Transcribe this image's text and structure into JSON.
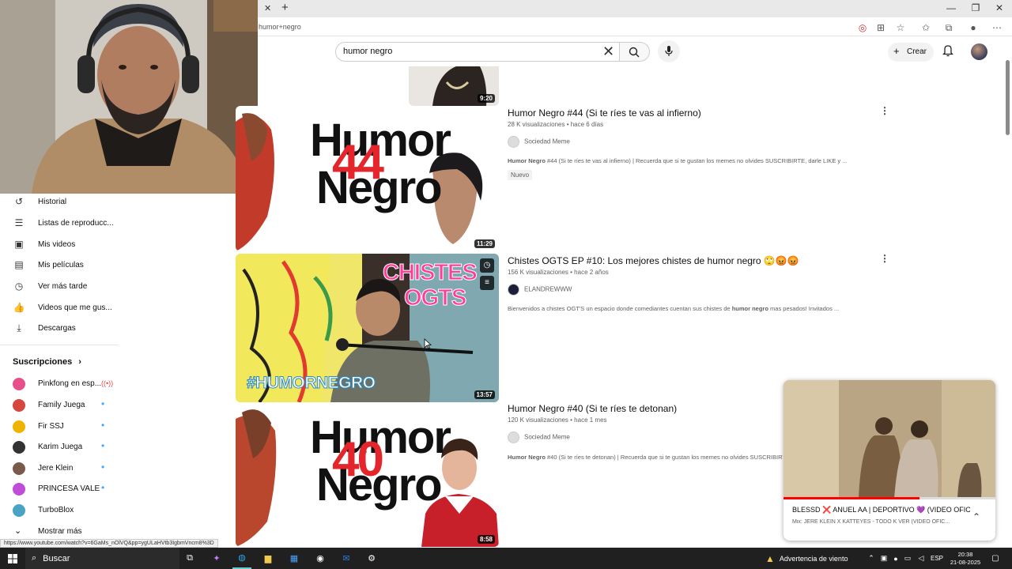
{
  "browser": {
    "url": "humor+negro",
    "tab_close": "✕",
    "new_tab": "+"
  },
  "header": {
    "search_query": "humor negro",
    "create_label": "Crear"
  },
  "sidebar": {
    "items": [
      {
        "icon": "history-icon",
        "label": "Historial"
      },
      {
        "icon": "playlist-icon",
        "label": "Listas de reproducc..."
      },
      {
        "icon": "my-videos-icon",
        "label": "Mis videos"
      },
      {
        "icon": "movies-icon",
        "label": "Mis películas"
      },
      {
        "icon": "watch-later-icon",
        "label": "Ver más tarde"
      },
      {
        "icon": "liked-icon",
        "label": "Videos que me gus..."
      },
      {
        "icon": "download-icon",
        "label": "Descargas"
      }
    ],
    "subscriptions_title": "Suscripciones",
    "subscriptions": [
      {
        "name": "Pinkfong en esp...",
        "color": "#e8508a",
        "live": true
      },
      {
        "name": "Family Juega",
        "color": "#d6473f",
        "live": false
      },
      {
        "name": "Fir SSJ",
        "color": "#f0b400",
        "live": false
      },
      {
        "name": "Karim Juega",
        "color": "#333333",
        "live": false
      },
      {
        "name": "Jere Klein",
        "color": "#7a5a4a",
        "live": false
      },
      {
        "name": "PRINCESA VALE",
        "color": "#c04dd8",
        "live": false
      },
      {
        "name": "TurboBlox",
        "color": "#4aa3c2",
        "live": false
      }
    ],
    "show_more": "Mostrar más"
  },
  "videos": [
    {
      "duration": "9:20"
    },
    {
      "title": "Humor Negro #44 (Si te ríes te vas al infierno)",
      "meta": "28 K visualizaciones • hace 6 días",
      "channel": "Sociedad Meme",
      "desc_bold": "Humor Negro",
      "desc": " #44 (Si te ríes te vas al infierno) | Recuerda que si te gustan los memes no olvides SUSCRIBIRTE, darle LIKE y ...",
      "badge": "Nuevo",
      "duration": "11:29",
      "thumb_text_top": "Humor",
      "thumb_text_bottom": "Negro",
      "thumb_number": "44"
    },
    {
      "title": "Chistes OGTS EP #10: Los mejores chistes de humor negro 🙄😡😡",
      "meta": "156 K visualizaciones • hace 2 años",
      "channel": "ELANDREWWW",
      "desc_pre": "Bienvenidos a chistes OGT'S un espacio donde comediantes cuentan sus chistes de ",
      "desc_bold": "humor negro",
      "desc_post": " mas pesados! Invitados ...",
      "duration": "13:57",
      "thumb_text_top": "CHISTES",
      "thumb_text_mid": "OGTS",
      "thumb_tag": "#HUMORNEGRO"
    },
    {
      "title": "Humor Negro #40 (Si te ríes te detonan)",
      "meta": "120 K visualizaciones • hace 1 mes",
      "channel": "Sociedad Meme",
      "desc_bold": "Humor Negro",
      "desc": " #40 (Si te ríes te detonan) | Recuerda que si te gustan los memes no olvides SUSCRIBIRTE",
      "duration": "8:58",
      "thumb_text_top": "Humor",
      "thumb_text_bottom": "Negro",
      "thumb_number": "40"
    }
  ],
  "mini_player": {
    "title": "BLESSD ❌ ANUEL AA | DEPORTIVO 💜 (VIDEO OFIC...",
    "subtitle": "Mix: JERE KLEIN X KATTEYES - TODO K VER (VIDEO OFIC...",
    "progress": 0.64
  },
  "status_url": "https://www.youtube.com/watch?v=6GaMs_nOlVQ&pp=ygULaHVtb3IgbmVncm8%3D",
  "taskbar": {
    "search_label": "Buscar",
    "weather": "Advertencia de viento",
    "lang": "ESP",
    "time": "20:38",
    "date": "21-08-2025"
  }
}
